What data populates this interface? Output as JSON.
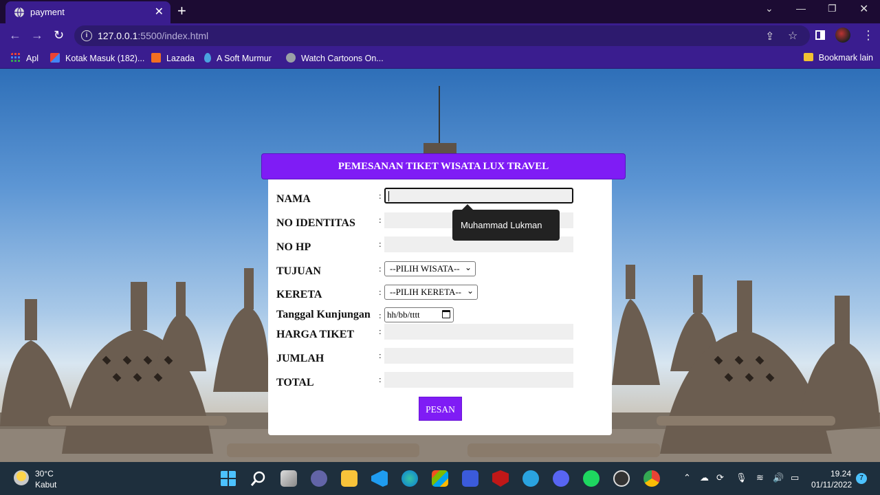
{
  "browser": {
    "tab_title": "payment",
    "tab_close": "✕",
    "new_tab": "+",
    "url_host": "127.0.0.1",
    "url_path": ":5500/index.html",
    "bookmarks": [
      {
        "label": "Apl",
        "color": "#e94335"
      },
      {
        "label": "Kotak Masuk (182)...",
        "color": "#ea4335"
      },
      {
        "label": "Lazada",
        "color": "#f36f21"
      },
      {
        "label": "A Soft Murmur",
        "color": "#4aa3df"
      },
      {
        "label": "Watch Cartoons On...",
        "color": "#9aa0a6"
      }
    ],
    "bookmarks_other": "Bookmark lain"
  },
  "form": {
    "header": "PEMESANAN TIKET WISATA LUX TRAVEL",
    "fields": [
      {
        "label": "NAMA",
        "value": ""
      },
      {
        "label": "NO IDENTITAS",
        "value": ""
      },
      {
        "label": "NO HP",
        "value": ""
      },
      {
        "label": "TUJUAN",
        "selected": "--PILIH WISATA--"
      },
      {
        "label": "KERETA",
        "selected": "--PILIH KERETA--"
      },
      {
        "label": "Tanggal Kunjungan",
        "placeholder": "hh/bb/tttt"
      },
      {
        "label": "HARGA TIKET",
        "value": ""
      },
      {
        "label": "JUMLAH",
        "value": ""
      },
      {
        "label": "TOTAL",
        "value": ""
      }
    ],
    "colon": ":",
    "submit_label": "PESAN",
    "tooltip": "Muhammad Lukman"
  },
  "taskbar": {
    "temperature": "30°C",
    "condition": "Kabut",
    "time": "19.24",
    "date": "01/11/2022",
    "notification_count": "7"
  },
  "colors": {
    "accent": "#7f1cf5",
    "browser_frame": "#3a1d8f"
  }
}
